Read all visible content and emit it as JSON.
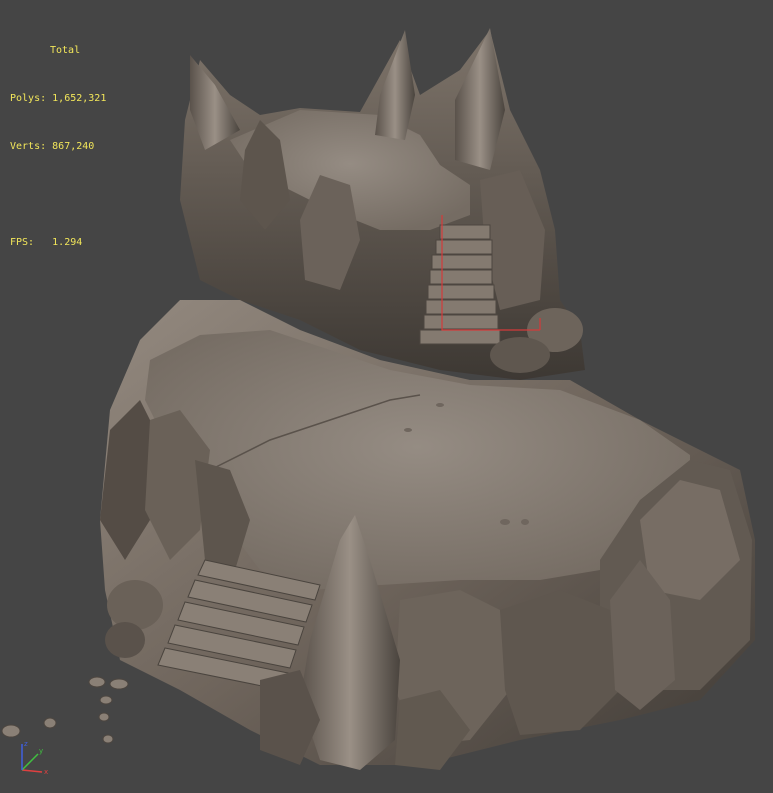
{
  "viewport": {
    "background": "#454545",
    "stats": {
      "heading": "Total",
      "polys_label": "Polys:",
      "polys_value": "1,652,321",
      "verts_label": "Verts:",
      "verts_value": "867,240",
      "fps_label": "FPS:",
      "fps_value": "1.294",
      "text_color": "#f2e65a"
    },
    "scene": {
      "object": "rock-plateau-model",
      "rock_color": "#7a6e64",
      "floor_color": "#8a8178",
      "selection_color": "#d43a3a"
    },
    "axis_gizmo": {
      "x_color": "#e04040",
      "y_color": "#40c040",
      "z_color": "#4060e0"
    }
  }
}
